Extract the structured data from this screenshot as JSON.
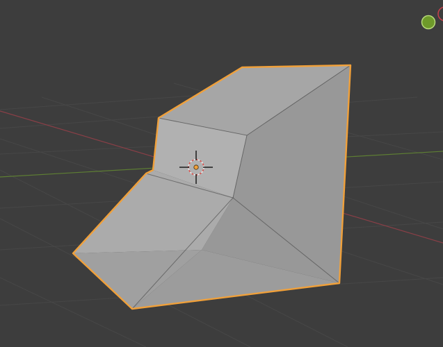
{
  "viewport": {
    "background": "#3d3d3d",
    "grid_color": "#474747",
    "x_axis_color": "#8a3f47",
    "y_axis_color": "#5e7f33"
  },
  "mesh": {
    "selected": true,
    "outline_color": "#f0a03a",
    "face_colors": {
      "top": "#a6a6a6",
      "right": "#989898",
      "upper_front": "#b1b1b1",
      "ramp": "#ababab",
      "lower_front": "#a0a0a0",
      "lower_right": "#9c9c9c"
    }
  },
  "cursor_3d": {
    "ring_color_a": "#d9534f",
    "ring_color_b": "#e8e8e8",
    "crosshair_color": "#111111"
  },
  "origin_dot": {
    "color": "#f0a03a"
  },
  "navigation_gizmo": {
    "y_axis_color": "#6e9a2a",
    "x_axis_color": "#c8404c"
  }
}
